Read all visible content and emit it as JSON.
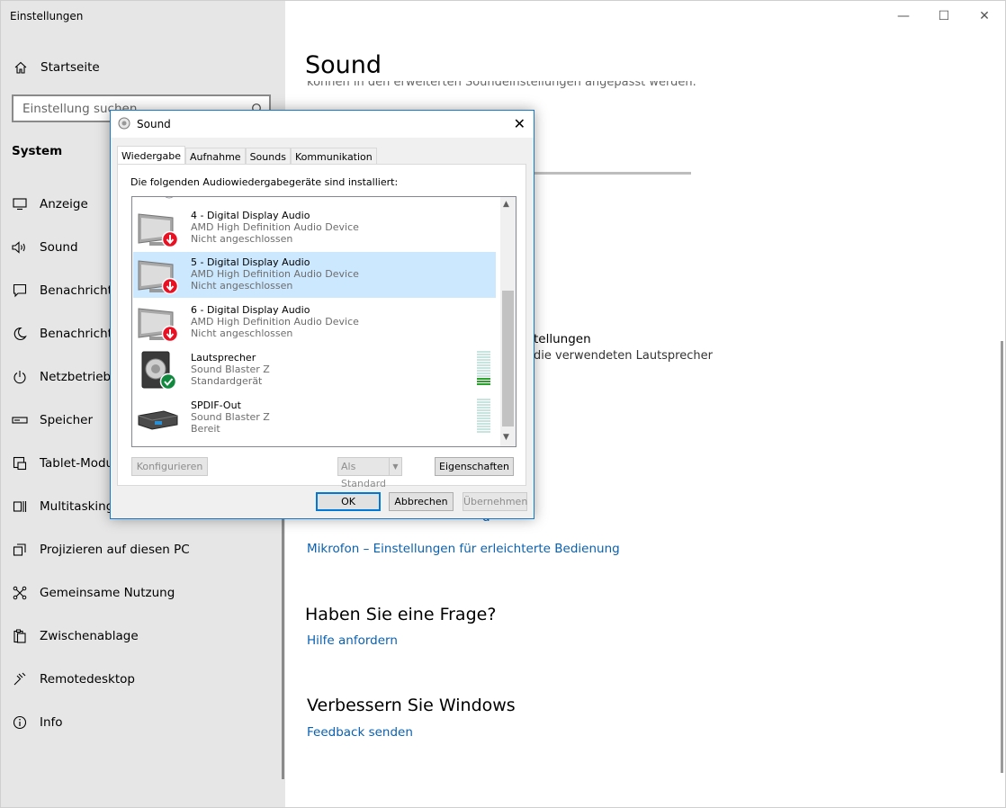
{
  "window": {
    "title": "Einstellungen",
    "controls": {
      "minimize": "—",
      "maximize": "☐",
      "close": "✕"
    }
  },
  "sidebar": {
    "home_label": "Startseite",
    "search_placeholder": "Einstellung suchen",
    "section_label": "System",
    "items": [
      {
        "label": "Anzeige",
        "icon": "display-icon"
      },
      {
        "label": "Sound",
        "icon": "speaker-icon"
      },
      {
        "label": "Benachrichtigungen und Aktionen",
        "icon": "notification-icon"
      },
      {
        "label": "Benachrichtigungsassistent",
        "icon": "moon-icon"
      },
      {
        "label": "Netzbetrieb und Energiesparen",
        "icon": "power-icon"
      },
      {
        "label": "Speicher",
        "icon": "storage-icon"
      },
      {
        "label": "Tablet-Modus",
        "icon": "tablet-icon"
      },
      {
        "label": "Multitasking",
        "icon": "multitasking-icon"
      },
      {
        "label": "Projizieren auf diesen PC",
        "icon": "project-icon"
      },
      {
        "label": "Gemeinsame Nutzung",
        "icon": "share-icon"
      },
      {
        "label": "Zwischenablage",
        "icon": "clipboard-icon"
      },
      {
        "label": "Remotedesktop",
        "icon": "remote-icon"
      },
      {
        "label": "Info",
        "icon": "info-icon"
      }
    ]
  },
  "main": {
    "page_title": "Sound",
    "cut_text": "können in den erweiterten Soundeinstellungen angepasst werden.",
    "partial_heading": "tellungen",
    "partial_text": "die verwendeten Lautsprecher",
    "partial_link": "g",
    "link_mikrofon": "Mikrofon – Einstellungen für erleichterte Bedienung",
    "question_heading": "Haben Sie eine Frage?",
    "help_link": "Hilfe anfordern",
    "improve_heading": "Verbessern Sie Windows",
    "feedback_link": "Feedback senden"
  },
  "dialog": {
    "title": "Sound",
    "tabs": [
      "Wiedergabe",
      "Aufnahme",
      "Sounds",
      "Kommunikation"
    ],
    "active_tab": "Wiedergabe",
    "list_label": "Die folgenden Audiowiedergabegeräte sind installiert:",
    "devices": [
      {
        "name": "4 - Digital Display Audio",
        "driver": "AMD High Definition Audio Device",
        "status": "Nicht angeschlossen",
        "type": "monitor",
        "badge": "disconnected",
        "selected": false
      },
      {
        "name": "5 - Digital Display Audio",
        "driver": "AMD High Definition Audio Device",
        "status": "Nicht angeschlossen",
        "type": "monitor",
        "badge": "disconnected",
        "selected": true
      },
      {
        "name": "6 - Digital Display Audio",
        "driver": "AMD High Definition Audio Device",
        "status": "Nicht angeschlossen",
        "type": "monitor",
        "badge": "disconnected",
        "selected": false
      },
      {
        "name": "Lautsprecher",
        "driver": "Sound Blaster Z",
        "status": "Standardgerät",
        "type": "speaker",
        "badge": "default",
        "selected": false,
        "level": 0.15
      },
      {
        "name": "SPDIF-Out",
        "driver": "Sound Blaster Z",
        "status": "Bereit",
        "type": "spdif",
        "badge": "none",
        "selected": false,
        "level": 0
      }
    ],
    "buttons": {
      "configure": "Konfigurieren",
      "set_default": "Als Standard",
      "properties": "Eigenschaften",
      "ok": "OK",
      "cancel": "Abbrechen",
      "apply": "Übernehmen"
    }
  },
  "colors": {
    "accent": "#0078d7",
    "link": "#0a60b0",
    "selection": "#cce8ff",
    "sidebar_bg": "#e6e6e6",
    "error_badge": "#e81123",
    "ok_badge": "#10893e"
  }
}
